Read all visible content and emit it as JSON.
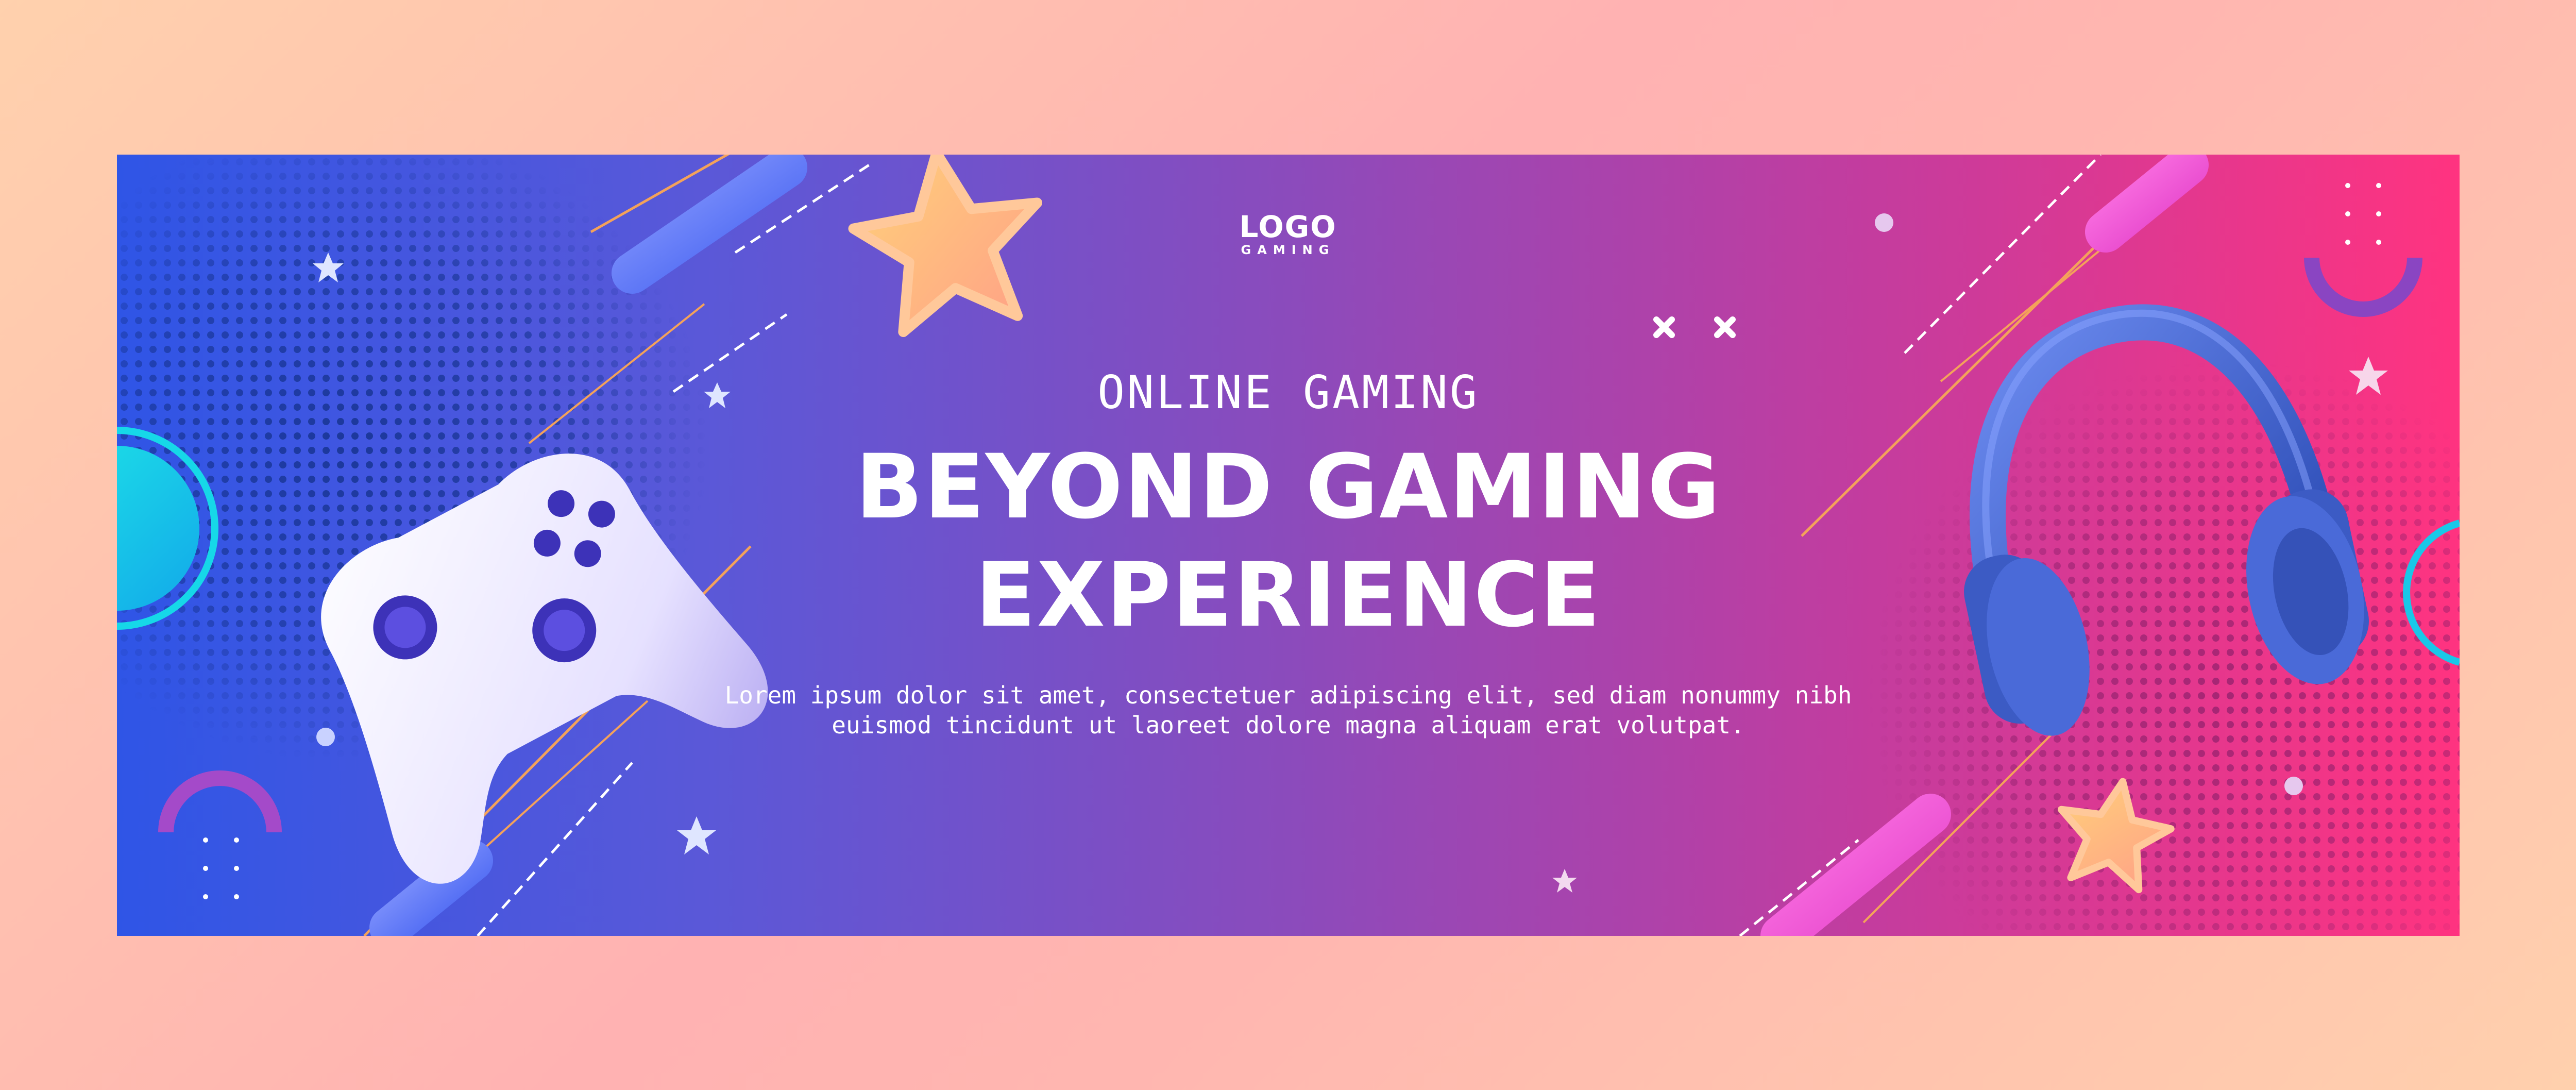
{
  "logo": {
    "main": "LOGO",
    "sub": "GAMING"
  },
  "hero": {
    "subtitle": "ONLINE GAMING",
    "headline_line1": "BEYOND GAMING",
    "headline_line2": "EXPERIENCE",
    "body_line1": "Lorem ipsum dolor sit amet, consectetuer adipiscing elit, sed diam nonummy nibh",
    "body_line2": "euismod tincidunt ut laoreet dolore magna aliquam erat volutpat."
  },
  "colors": {
    "banner_left": "#2f55e6",
    "banner_mid": "#8b4bbc",
    "banner_right": "#ff3380",
    "outer_bg": "#ffb6b0",
    "text": "#ffffff"
  },
  "icons": [
    "gamepad-icon",
    "headphones-icon",
    "star-icon",
    "x-icon"
  ]
}
